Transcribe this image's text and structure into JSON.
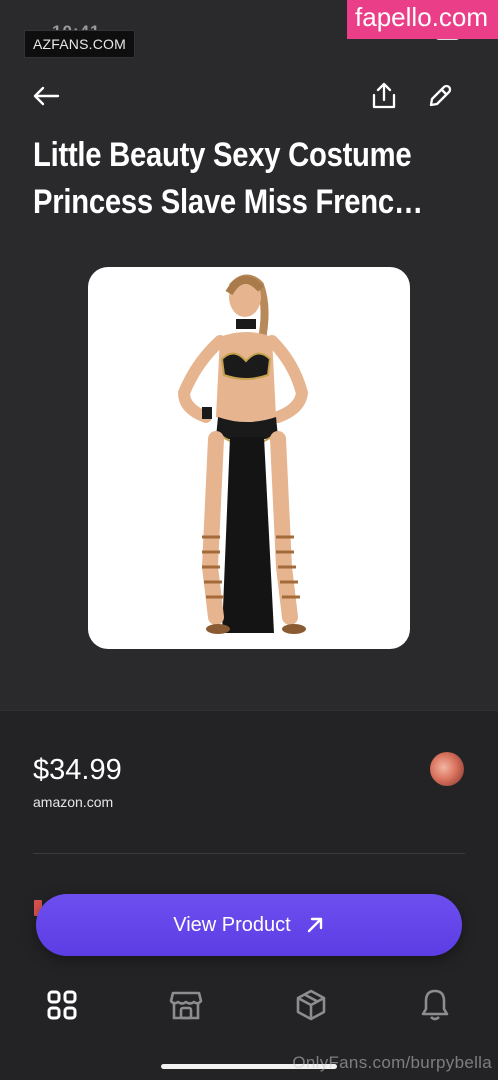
{
  "status_bar": {
    "time": "10:41",
    "battery": "97"
  },
  "watermarks": {
    "left": "AZFANS.COM",
    "right": "fapello.com",
    "bottom": "OnlyFans.com/burpybella"
  },
  "header": {
    "back_icon": "arrow-left-icon",
    "share_icon": "share-icon",
    "edit_icon": "pencil-icon"
  },
  "product": {
    "title": "Little Beauty Sexy Costume Princess Slave Miss Frenc…",
    "image_alt": "product-photo",
    "price": "$34.99",
    "store": "amazon.com"
  },
  "cta": {
    "label": "View Product",
    "icon": "arrow-up-right-icon"
  },
  "bottom_nav": {
    "items": [
      {
        "icon": "grid-icon",
        "active": true
      },
      {
        "icon": "storefront-icon",
        "active": false
      },
      {
        "icon": "box-icon",
        "active": false
      },
      {
        "icon": "bell-icon",
        "active": false
      }
    ]
  },
  "colors": {
    "background": "#2a2a2c",
    "panel": "#232325",
    "accent": "#5b3de4",
    "watermark_pink": "#ea3f88"
  }
}
